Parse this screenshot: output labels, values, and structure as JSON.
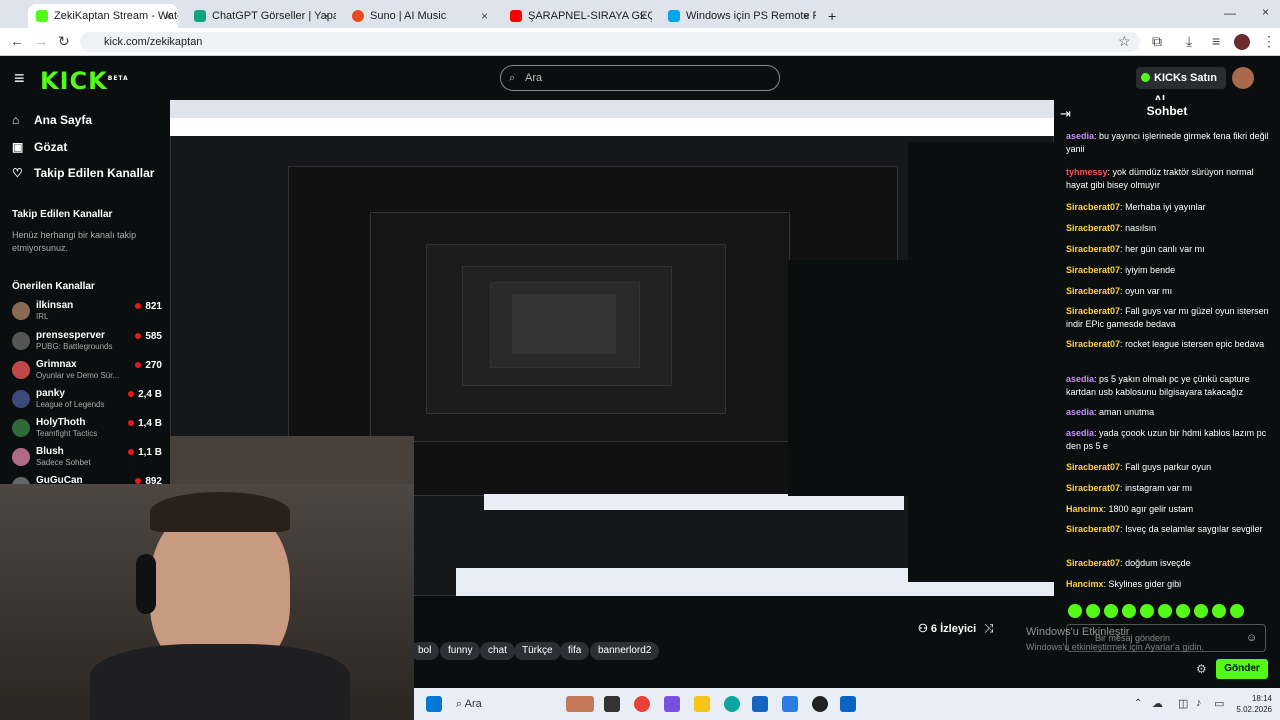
{
  "browser": {
    "tabs": [
      {
        "label": "ZekiKaptan Stream - Watch Live",
        "color": "#53fc18",
        "active": true
      },
      {
        "label": "ChatGPT Görseller | Yapay Zekâ",
        "color": "#10a37f"
      },
      {
        "label": "Suno | AI Music",
        "color": "#e84a1d"
      },
      {
        "label": "ŞARAPNEL-SIRAYA GEÇ - YouTube",
        "color": "#ff0000"
      },
      {
        "label": "Windows için PS Remote Play",
        "color": "#00a4ef"
      }
    ],
    "new_tab": "+",
    "url": "kick.com/zekikaptan"
  },
  "kick": {
    "logo": "KICK",
    "logo_badge": "BETA",
    "search_placeholder": "Ara",
    "kicks_button": "KICKs Satın Al",
    "nav": [
      {
        "label": "Ana Sayfa",
        "icon": "home-icon"
      },
      {
        "label": "Gözat",
        "icon": "browse-icon"
      },
      {
        "label": "Takip Edilen Kanallar",
        "icon": "heart-icon"
      }
    ],
    "followed_title": "Takip Edilen Kanallar",
    "followed_empty": "Henüz herhangi bir kanalı takip etmiyorsunuz.",
    "recommended_title": "Önerilen Kanallar",
    "channels": [
      {
        "name": "ilkinsan",
        "game": "IRL",
        "viewers": "821"
      },
      {
        "name": "prensesperver",
        "game": "PUBG: Battlegrounds",
        "viewers": "585"
      },
      {
        "name": "Grimnax",
        "game": "Oyunlar ve Demo Sür...",
        "viewers": "270"
      },
      {
        "name": "panky",
        "game": "League of Legends",
        "viewers": "2,4 B"
      },
      {
        "name": "HolyThoth",
        "game": "Teamfight Tactics",
        "viewers": "1,4 B"
      },
      {
        "name": "Blush",
        "game": "Sadece Sohbet",
        "viewers": "1,1 B"
      },
      {
        "name": "GuGuCan",
        "game": "",
        "viewers": "892"
      }
    ]
  },
  "chat": {
    "title": "Sohbet",
    "messages": [
      {
        "user": "asedia",
        "text": "bu yayıncı işlerinede girmek fena fikri değil yanii",
        "color": "#c78bff"
      },
      {
        "user": "tyhmessy",
        "text": "yok dümdüz traktör sürüyon normal hayat gibi bisey olmuyır",
        "color": "#ff4d4d"
      },
      {
        "user": "Siracberat07",
        "text": "Merhaba iyi yayınlar",
        "color": "#ffd23c"
      },
      {
        "user": "Siracberat07",
        "text": "nasılsın",
        "color": "#ffd23c"
      },
      {
        "user": "Siracberat07",
        "text": "her gün canlı var mı",
        "color": "#ffd23c"
      },
      {
        "user": "Siracberat07",
        "text": "iyiyim bende",
        "color": "#ffd23c"
      },
      {
        "user": "Siracberat07",
        "text": "oyun var mı",
        "color": "#ffd23c"
      },
      {
        "user": "Siracberat07",
        "text": "Fall guys var mı güzel oyun istersen indir EPic gamesde bedava",
        "color": "#ffd23c"
      },
      {
        "user": "Siracberat07",
        "text": "rocket league istersen epic bedava",
        "color": "#ffd23c"
      },
      {
        "user": "asedia",
        "text": "ps 5 yakın olmalı pc ye çünkü capture kartdan usb kablosunu bilgisayara takacağız",
        "color": "#c78bff"
      },
      {
        "user": "asedia",
        "text": "aman unutma",
        "color": "#c78bff"
      },
      {
        "user": "asedia",
        "text": "yada çoook uzun bir hdmi kablos lazım pc den ps 5 e",
        "color": "#c78bff"
      },
      {
        "user": "Siracberat07",
        "text": "Fall guys parkur oyun",
        "color": "#ffd23c"
      },
      {
        "user": "Siracberat07",
        "text": "instagram var mı",
        "color": "#ffd23c"
      },
      {
        "user": "Hancimx",
        "text": "1800 agır gelir ustam",
        "color": "#ffd23c"
      },
      {
        "user": "Siracberat07",
        "text": "Isveç da selamlar saygılar sevgiler",
        "color": "#ffd23c"
      },
      {
        "user": "Siracberat07",
        "text": "doğdum isveçde",
        "color": "#ffd23c"
      },
      {
        "user": "Hancimx",
        "text": "Skylines gider gibi",
        "color": "#ffd23c"
      }
    ],
    "input_placeholder": "Bir mesaj gönderin",
    "send_label": "Gönder"
  },
  "stream": {
    "viewers": "6 İzleyici",
    "tags": [
      "bol",
      "funny",
      "chat",
      "Türkçe",
      "fifa",
      "bannerlord2"
    ]
  },
  "watermark": {
    "line1": "Windows'u Etkinleştir",
    "line2": "Windows'u etkinleştirmek için Ayarlar'a gidin."
  },
  "taskbar": {
    "search": "Ara",
    "time": "18:14",
    "date": "5.02.2026"
  }
}
